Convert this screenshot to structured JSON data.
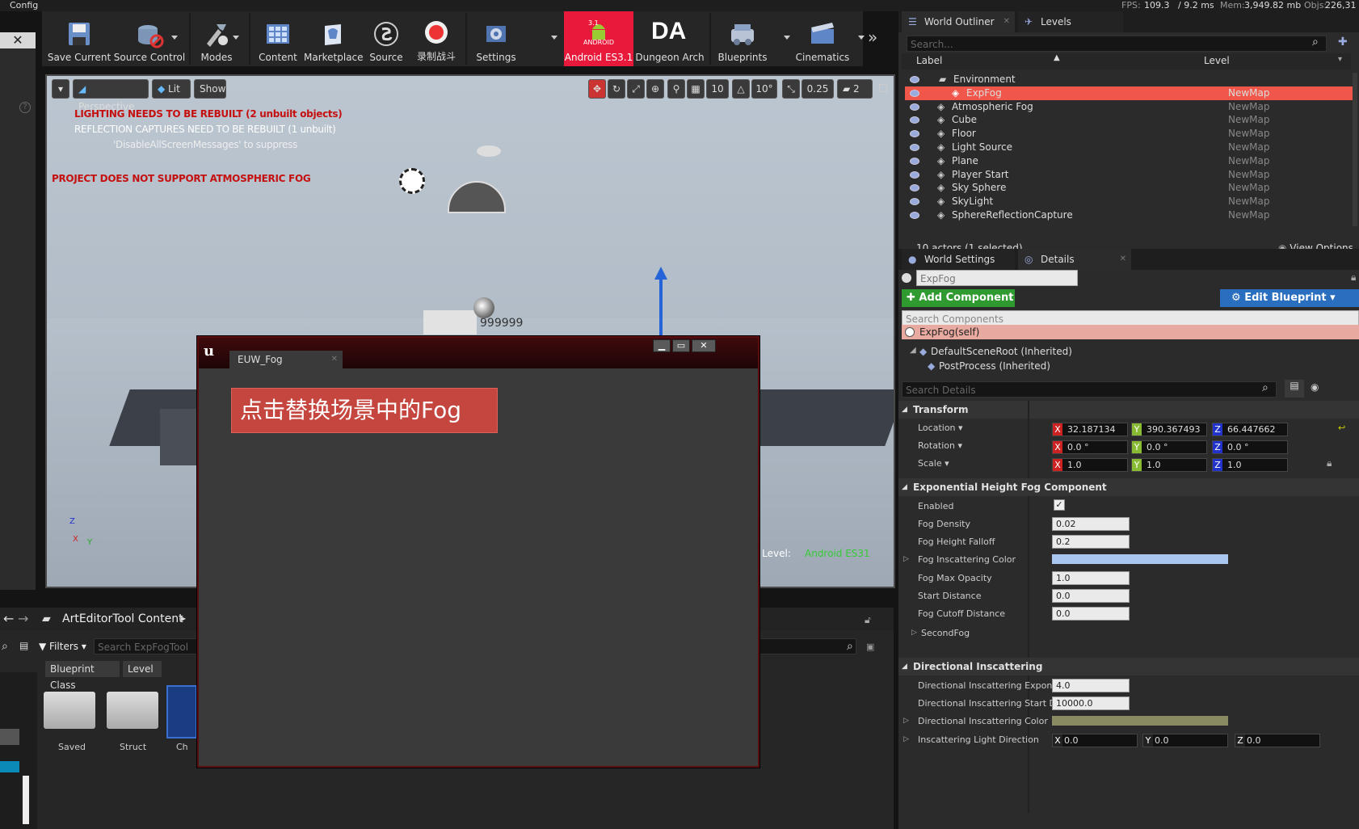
{
  "menubar": {
    "config": "Config",
    "fps_label": "FPS:",
    "fps_value": "109.3",
    "ms": "/ 9.2 ms",
    "mem_label": "Mem:",
    "mem_value": "3,949.82 mb",
    "objs_label": "Objs:",
    "objs_value": "226,31"
  },
  "toolbar": {
    "save_current": "Save Current",
    "source_control": "Source Control",
    "modes": "Modes",
    "content": "Content",
    "marketplace": "Marketplace",
    "source": "Source",
    "record": "录制战斗",
    "settings": "Settings",
    "android": "Android ES3.1",
    "android_badge": "3.1",
    "android_top": "ANDROID",
    "dungeon": "Dungeon Arch",
    "dungeon_logo": "DA",
    "blueprints": "Blueprints",
    "cinematics": "Cinematics"
  },
  "viewport": {
    "perspective": "Perspective",
    "lit": "Lit",
    "show": "Show",
    "grid_snap": "10",
    "rot_snap": "10°",
    "scale_snap": "0.25",
    "cam_speed": "2",
    "msg_lighting": "LIGHTING NEEDS TO BE REBUILT (2 unbuilt objects)",
    "msg_reflection": "REFLECTION CAPTURES NEED TO BE REBUILT (1 unbuilt)",
    "msg_suppress": "'DisableAllScreenMessages' to suppress",
    "msg_atmos": "PROJECT DOES NOT SUPPORT ATMOSPHERIC FOG",
    "feature_level_label": "Feature Level:",
    "feature_level_value": "Android ES31",
    "cube_label": "999999",
    "axis_z": "Z",
    "axis_x": "X",
    "axis_y": "Y"
  },
  "dialog": {
    "tab": "EUW_Fog",
    "button": "点击替换场景中的Fog"
  },
  "content_browser": {
    "title": "ArtEditorTool Content",
    "filters": "Filters",
    "search_placeholder": "Search ExpFogTool",
    "chips": [
      "Blueprint Class",
      "Level"
    ],
    "items": [
      "Saved",
      "Struct",
      "Ch"
    ]
  },
  "outliner": {
    "tab1": "World Outliner",
    "tab2": "Levels",
    "search_placeholder": "Search...",
    "col_label": "Label",
    "col_level": "Level",
    "rows": [
      {
        "name": "Environment",
        "level": ""
      },
      {
        "name": "ExpFog",
        "level": "NewMap"
      },
      {
        "name": "Atmospheric Fog",
        "level": "NewMap"
      },
      {
        "name": "Cube",
        "level": "NewMap"
      },
      {
        "name": "Floor",
        "level": "NewMap"
      },
      {
        "name": "Light Source",
        "level": "NewMap"
      },
      {
        "name": "Plane",
        "level": "NewMap"
      },
      {
        "name": "Player Start",
        "level": "NewMap"
      },
      {
        "name": "Sky Sphere",
        "level": "NewMap"
      },
      {
        "name": "SkyLight",
        "level": "NewMap"
      },
      {
        "name": "SphereReflectionCapture",
        "level": "NewMap"
      }
    ],
    "status": "10 actors (1 selected)",
    "view_options": "View Options"
  },
  "details": {
    "tab1": "World Settings",
    "tab2": "Details",
    "actor_name": "ExpFog",
    "add_component": "Add Component",
    "edit_blueprint": "Edit Blueprint",
    "search_components": "Search Components",
    "self_row": "ExpFog(self)",
    "root_row": "DefaultSceneRoot (Inherited)",
    "pp_row": "PostProcess (Inherited)",
    "search_details": "Search Details",
    "transform": "Transform",
    "location": "Location",
    "rotation": "Rotation",
    "scale": "Scale",
    "loc": [
      "32.187134",
      "390.367493",
      "66.447662"
    ],
    "rot": [
      "0.0 °",
      "0.0 °",
      "0.0 °"
    ],
    "scl": [
      "1.0",
      "1.0",
      "1.0"
    ],
    "fog_section": "Exponential Height Fog Component",
    "enabled": "Enabled",
    "fog_density": "Fog Density",
    "fog_density_v": "0.02",
    "fog_height_falloff": "Fog Height Falloff",
    "fog_height_falloff_v": "0.2",
    "fog_inscattering_color": "Fog Inscattering Color",
    "fog_max_opacity": "Fog Max Opacity",
    "fog_max_opacity_v": "1.0",
    "start_distance": "Start Distance",
    "start_distance_v": "0.0",
    "fog_cutoff": "Fog Cutoff Distance",
    "fog_cutoff_v": "0.0",
    "second_fog": "SecondFog",
    "dir_section": "Directional Inscattering",
    "dir_exp": "Directional Inscattering Exponent",
    "dir_exp_v": "4.0",
    "dir_start": "Directional Inscattering Start Distar",
    "dir_start_v": "10000.0",
    "dir_color": "Directional Inscattering Color",
    "light_dir": "Inscattering Light Direction",
    "light_dir_v": [
      "0.0",
      "0.0",
      "0.0"
    ],
    "axes": [
      "X",
      "Y",
      "Z"
    ]
  },
  "colors": {
    "fog_color": "#a9c6f0",
    "dir_color": "#8a8a62",
    "selected_row": "#f0574a",
    "add_component": "#2f9a2f",
    "edit_blueprint": "#2a6fbf"
  }
}
